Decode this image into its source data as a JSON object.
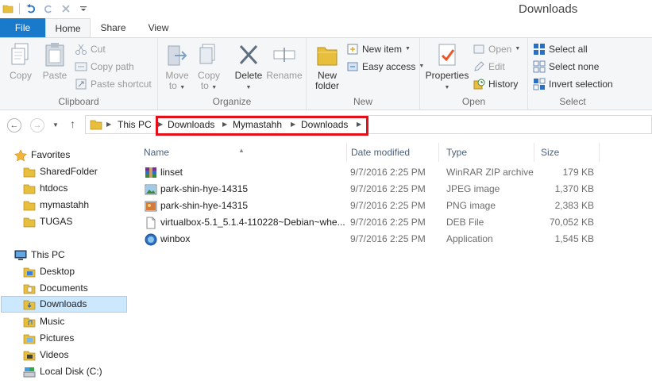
{
  "window": {
    "title": "Downloads"
  },
  "tabs": {
    "file": "File",
    "home": "Home",
    "share": "Share",
    "view": "View"
  },
  "ribbon": {
    "clipboard": {
      "label": "Clipboard",
      "copy": "Copy",
      "paste": "Paste",
      "cut": "Cut",
      "copy_path": "Copy path",
      "paste_shortcut": "Paste shortcut"
    },
    "organize": {
      "label": "Organize",
      "move_to_1": "Move",
      "move_to_2": "to",
      "copy_to_1": "Copy",
      "copy_to_2": "to",
      "delete": "Delete",
      "rename": "Rename"
    },
    "new": {
      "label": "New",
      "new_folder_1": "New",
      "new_folder_2": "folder",
      "new_item": "New item",
      "easy_access": "Easy access"
    },
    "open": {
      "label": "Open",
      "properties": "Properties",
      "open": "Open",
      "edit": "Edit",
      "history": "History"
    },
    "select": {
      "label": "Select",
      "select_all": "Select all",
      "select_none": "Select none",
      "invert": "Invert selection"
    }
  },
  "address": {
    "root": "This PC",
    "crumbs": [
      "Downloads",
      "Mymastahh",
      "Downloads"
    ]
  },
  "nav": {
    "favorites": "Favorites",
    "fav_items": [
      "SharedFolder",
      "htdocs",
      "mymastahh",
      "TUGAS"
    ],
    "thispc": "This PC",
    "pc_items": [
      "Desktop",
      "Documents",
      "Downloads",
      "Music",
      "Pictures",
      "Videos",
      "Local Disk (C:)"
    ]
  },
  "columns": {
    "name": "Name",
    "date": "Date modified",
    "type": "Type",
    "size": "Size"
  },
  "files": [
    {
      "name": "linset",
      "date": "9/7/2016 2:25 PM",
      "type": "WinRAR ZIP archive",
      "size": "179 KB",
      "icon": "winrar-icon"
    },
    {
      "name": "park-shin-hye-14315",
      "date": "9/7/2016 2:25 PM",
      "type": "JPEG image",
      "size": "1,370 KB",
      "icon": "jpeg-icon"
    },
    {
      "name": "park-shin-hye-14315",
      "date": "9/7/2016 2:25 PM",
      "type": "PNG image",
      "size": "2,383 KB",
      "icon": "png-icon"
    },
    {
      "name": "virtualbox-5.1_5.1.4-110228~Debian~whe...",
      "date": "9/7/2016 2:25 PM",
      "type": "DEB File",
      "size": "70,052 KB",
      "icon": "deb-file-icon"
    },
    {
      "name": "winbox",
      "date": "9/7/2016 2:25 PM",
      "type": "Application",
      "size": "1,545 KB",
      "icon": "application-icon"
    }
  ],
  "colors": {
    "accent": "#1979ca",
    "highlight_box": "#e3101a",
    "selected_bg": "#cce8ff",
    "folder": "#e8bf3c"
  }
}
